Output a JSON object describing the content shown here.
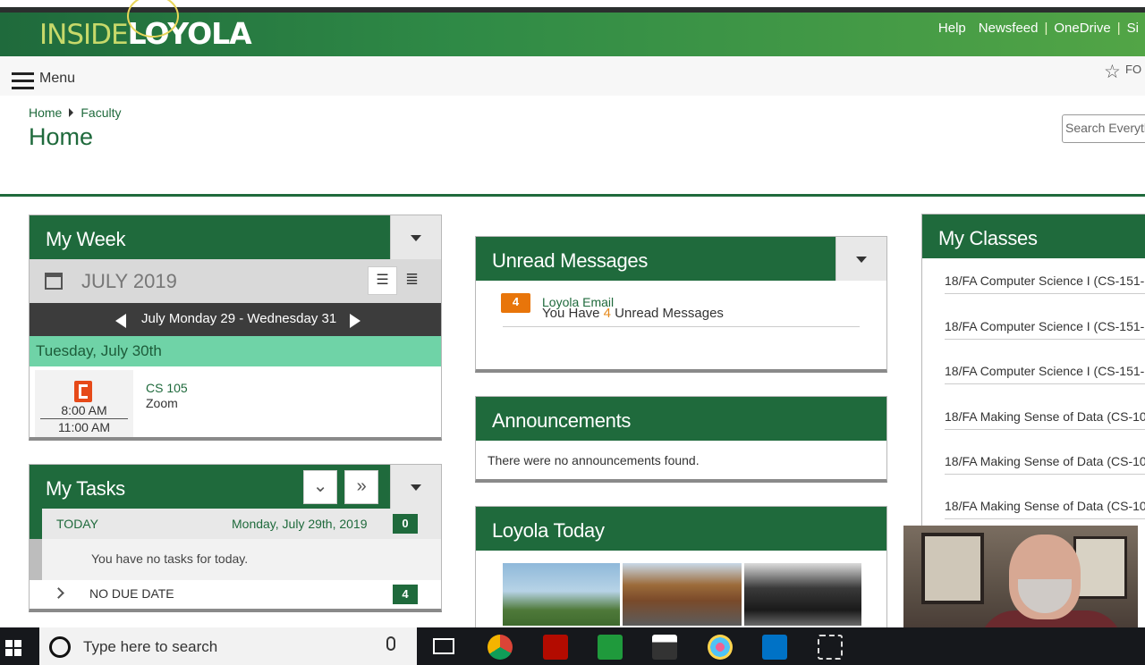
{
  "header": {
    "logo_part1": "INSIDE",
    "logo_part2": "LOYOLA",
    "links": [
      "Help",
      "Newsfeed",
      "OneDrive",
      "Si"
    ],
    "separator": "|"
  },
  "menubar": {
    "menu_label": "Menu",
    "favorite_label": "FO"
  },
  "breadcrumb": {
    "home": "Home",
    "faculty": "Faculty"
  },
  "page_title": "Home",
  "search": {
    "placeholder": "Search Everyth"
  },
  "my_week": {
    "title": "My Week",
    "month": "JULY 2019",
    "range": "July Monday 29 - Wednesday 31",
    "day_label": "Tuesday, July 30th",
    "event": {
      "start": "8:00 AM",
      "end": "11:00 AM",
      "course": "CS 105",
      "location": "Zoom"
    }
  },
  "my_tasks": {
    "title": "My Tasks",
    "today_label": "TODAY",
    "today_date": "Monday, July 29th, 2019",
    "today_count": "0",
    "empty_message": "You have no tasks for today.",
    "no_due_label": "NO DUE DATE",
    "no_due_count": "4"
  },
  "unread": {
    "title": "Unread Messages",
    "prefix": "You Have ",
    "count": "4",
    "suffix": " Unread Messages",
    "email_count": "4",
    "email_label": "Loyola Email"
  },
  "announcements": {
    "title": "Announcements",
    "message": "There were no announcements found."
  },
  "loyola_today": {
    "title": "Loyola Today"
  },
  "my_classes": {
    "title": "My Classes",
    "items": [
      "18/FA Computer Science I (CS-151-",
      "18/FA Computer Science I (CS-151-",
      "18/FA Computer Science I (CS-151-",
      "18/FA Making Sense of Data (CS-10",
      "18/FA Making Sense of Data (CS-10",
      "18/FA Making Sense of Data (CS-10"
    ]
  },
  "taskbar": {
    "search_placeholder": "Type here to search"
  },
  "colors": {
    "brand_green": "#1f6a3c",
    "accent_orange": "#e8750a",
    "day_highlight": "#6fd3a7"
  }
}
